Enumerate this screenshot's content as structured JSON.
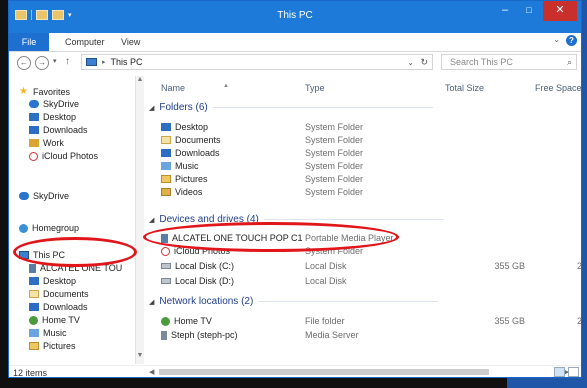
{
  "window": {
    "title": "This PC",
    "accent": "#1d7ad8",
    "controls": {
      "minimize": "–",
      "maximize": "□",
      "close": "✕"
    }
  },
  "ribbon": {
    "tabs": [
      "File",
      "Computer",
      "View"
    ],
    "help": "?"
  },
  "address": {
    "path_root": "This PC",
    "search_placeholder": "Search This PC"
  },
  "nav": {
    "favorites_label": "Favorites",
    "favorites": [
      "SkyDrive",
      "Desktop",
      "Downloads",
      "Work",
      "iCloud Photos"
    ],
    "skydrive": "SkyDrive",
    "homegroup": "Homegroup",
    "thispc": "This PC",
    "thispc_children": [
      "ALCATEL ONE TOU",
      "Desktop",
      "Documents",
      "Downloads",
      "Home TV",
      "Music",
      "Pictures"
    ]
  },
  "columns": {
    "name": "Name",
    "type": "Type",
    "total": "Total Size",
    "free": "Free Space"
  },
  "groups": {
    "folders": {
      "label": "Folders (6)",
      "items": [
        {
          "name": "Desktop",
          "type": "System Folder",
          "icon": "desktop-icon"
        },
        {
          "name": "Documents",
          "type": "System Folder",
          "icon": "documents-icon"
        },
        {
          "name": "Downloads",
          "type": "System Folder",
          "icon": "downloads-icon"
        },
        {
          "name": "Music",
          "type": "System Folder",
          "icon": "music-icon"
        },
        {
          "name": "Pictures",
          "type": "System Folder",
          "icon": "pictures-icon"
        },
        {
          "name": "Videos",
          "type": "System Folder",
          "icon": "videos-icon"
        }
      ]
    },
    "devices": {
      "label": "Devices and drives (4)",
      "items": [
        {
          "name": "ALCATEL ONE TOUCH POP C1",
          "type": "Portable Media Player",
          "total": "",
          "free": ""
        },
        {
          "name": "iCloud Photos",
          "type": "System Folder",
          "total": "",
          "free": ""
        },
        {
          "name": "Local Disk (C:)",
          "type": "Local Disk",
          "total": "355 GB",
          "free": "2"
        },
        {
          "name": "Local Disk (D:)",
          "type": "Local Disk",
          "total": "",
          "free": ""
        }
      ]
    },
    "network": {
      "label": "Network locations (2)",
      "items": [
        {
          "name": "Home TV",
          "type": "File folder",
          "total": "355 GB",
          "free": "2"
        },
        {
          "name": "Steph (steph-pc)",
          "type": "Media Server",
          "total": "",
          "free": ""
        }
      ]
    }
  },
  "status": {
    "count": "12 items"
  },
  "annotation_color": "#e0161b"
}
